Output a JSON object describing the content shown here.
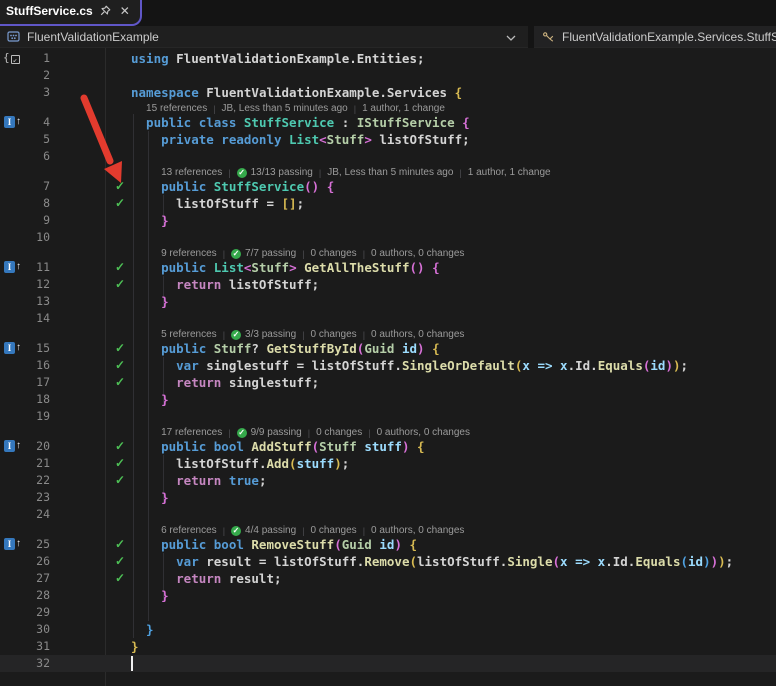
{
  "tab": {
    "title": "StuffService.cs",
    "pin_icon": "pin-icon",
    "close_icon": "✕"
  },
  "breadcrumb": {
    "project": "FluentValidationExample",
    "chevron": "⌄",
    "path": "FluentValidationExample.Services.StuffService"
  },
  "colors": {
    "accent_tab_border": "#6057c8",
    "arrow_red": "#e23b2e",
    "coverage_green": "#4dbf55",
    "codelens_pass_green": "#35a94b",
    "keyword_blue": "#569cd6",
    "control_keyword_pink": "#c586c0",
    "class_teal": "#4ec9b0",
    "type_green": "#b5cea8",
    "method_yellow": "#dcdcaa",
    "parameter_blue": "#9cdcfe",
    "bracket_gold": "#d7ba52",
    "bracket_orchid": "#d670d6",
    "bracket_blue": "#4fa1e0",
    "editor_bg": "#1b1b1b"
  },
  "editor": {
    "impl_icon_letter": "I",
    "impl_icon_arrow": "↑",
    "usings_icon_brace": "{",
    "usings_icon_arrow": "↙",
    "check_glyph": "✓",
    "cursor_line": 32,
    "lines": [
      {
        "n": 1,
        "ind": 0,
        "usings_icon": true,
        "tokens": [
          [
            "using ",
            "kw"
          ],
          [
            "FluentValidationExample.Entities;",
            "pln"
          ]
        ]
      },
      {
        "n": 2,
        "ind": 0,
        "tokens": []
      },
      {
        "n": 3,
        "ind": 0,
        "tokens": [
          [
            "namespace ",
            "kw"
          ],
          [
            "FluentValidationExample.Services ",
            "pln"
          ],
          [
            "{",
            "b1"
          ]
        ]
      },
      {
        "n": 4,
        "ind": 2,
        "impl_icon": true,
        "lens": {
          "ind": 2,
          "segs": [
            {
              "t": "15 references"
            },
            {
              "t": "JB, Less than 5 minutes ago"
            },
            {
              "t": "1 author, 1 change"
            }
          ]
        },
        "tokens": [
          [
            "public class ",
            "kw"
          ],
          [
            "StuffService",
            "cls"
          ],
          [
            " : ",
            "pln"
          ],
          [
            "IStuffService",
            "itf"
          ],
          [
            " ",
            "pln"
          ],
          [
            "{",
            "b2"
          ]
        ]
      },
      {
        "n": 5,
        "ind": 4,
        "tokens": [
          [
            "private readonly ",
            "kw"
          ],
          [
            "List",
            "cls"
          ],
          [
            "<",
            "b2"
          ],
          [
            "Stuff",
            "itf"
          ],
          [
            ">",
            "b2"
          ],
          [
            " listOfStuff;",
            "pln"
          ]
        ]
      },
      {
        "n": 6,
        "ind": 0,
        "tokens": []
      },
      {
        "n": 7,
        "ind": 4,
        "check": true,
        "lens": {
          "ind": 4,
          "segs": [
            {
              "t": "13 references"
            },
            {
              "t": "13/13 passing",
              "pass": true
            },
            {
              "t": "JB, Less than 5 minutes ago"
            },
            {
              "t": "1 author, 1 change"
            }
          ]
        },
        "tokens": [
          [
            "public ",
            "kw"
          ],
          [
            "StuffService",
            "cls"
          ],
          [
            "(",
            "b2"
          ],
          [
            ")",
            "b2"
          ],
          [
            " ",
            "pln"
          ],
          [
            "{",
            "b2"
          ]
        ]
      },
      {
        "n": 8,
        "ind": 6,
        "check": true,
        "tokens": [
          [
            "listOfStuff",
            "pln"
          ],
          [
            " = ",
            "pln"
          ],
          [
            "[]",
            "b1"
          ],
          [
            ";",
            "pln"
          ]
        ]
      },
      {
        "n": 9,
        "ind": 4,
        "tokens": [
          [
            "}",
            "b2"
          ]
        ]
      },
      {
        "n": 10,
        "ind": 0,
        "tokens": []
      },
      {
        "n": 11,
        "ind": 4,
        "impl_icon": true,
        "check": true,
        "lens": {
          "ind": 4,
          "segs": [
            {
              "t": "9 references"
            },
            {
              "t": "7/7 passing",
              "pass": true
            },
            {
              "t": "0 changes"
            },
            {
              "t": "0 authors, 0 changes"
            }
          ]
        },
        "tokens": [
          [
            "public ",
            "kw"
          ],
          [
            "List",
            "cls"
          ],
          [
            "<",
            "b2"
          ],
          [
            "Stuff",
            "itf"
          ],
          [
            ">",
            "b2"
          ],
          [
            " ",
            "pln"
          ],
          [
            "GetAllTheStuff",
            "mth"
          ],
          [
            "(",
            "b2"
          ],
          [
            ")",
            "b2"
          ],
          [
            " ",
            "pln"
          ],
          [
            "{",
            "b2"
          ]
        ]
      },
      {
        "n": 12,
        "ind": 6,
        "check": true,
        "tokens": [
          [
            "return ",
            "ctl"
          ],
          [
            "listOfStuff;",
            "pln"
          ]
        ]
      },
      {
        "n": 13,
        "ind": 4,
        "tokens": [
          [
            "}",
            "b2"
          ]
        ]
      },
      {
        "n": 14,
        "ind": 0,
        "tokens": []
      },
      {
        "n": 15,
        "ind": 4,
        "impl_icon": true,
        "check": true,
        "lens": {
          "ind": 4,
          "segs": [
            {
              "t": "5 references"
            },
            {
              "t": "3/3 passing",
              "pass": true
            },
            {
              "t": "0 changes"
            },
            {
              "t": "0 authors, 0 changes"
            }
          ]
        },
        "tokens": [
          [
            "public ",
            "kw"
          ],
          [
            "Stuff",
            "itf"
          ],
          [
            "? ",
            "pln"
          ],
          [
            "GetStuffById",
            "mth"
          ],
          [
            "(",
            "b2"
          ],
          [
            "Guid",
            "itf"
          ],
          [
            " ",
            "pln"
          ],
          [
            "id",
            "prm"
          ],
          [
            ")",
            "b2"
          ],
          [
            " ",
            "pln"
          ],
          [
            "{",
            "b1"
          ]
        ]
      },
      {
        "n": 16,
        "ind": 6,
        "check": true,
        "tokens": [
          [
            "var ",
            "kw"
          ],
          [
            "singlestuff",
            "pln"
          ],
          [
            " = ",
            "pln"
          ],
          [
            "listOfStuff",
            "pln"
          ],
          [
            ".",
            "pln"
          ],
          [
            "SingleOrDefault",
            "mth"
          ],
          [
            "(",
            "b1"
          ],
          [
            "x",
            "prm"
          ],
          [
            " ",
            "pln"
          ],
          [
            "=>",
            "prm"
          ],
          [
            " ",
            "pln"
          ],
          [
            "x",
            "prm"
          ],
          [
            ".",
            "pln"
          ],
          [
            "Id",
            "pln"
          ],
          [
            ".",
            "pln"
          ],
          [
            "Equals",
            "mth"
          ],
          [
            "(",
            "b2"
          ],
          [
            "id",
            "prm"
          ],
          [
            ")",
            "b2"
          ],
          [
            ")",
            "b1"
          ],
          [
            ";",
            "pln"
          ]
        ]
      },
      {
        "n": 17,
        "ind": 6,
        "check": true,
        "tokens": [
          [
            "return ",
            "ctl"
          ],
          [
            "singlestuff;",
            "pln"
          ]
        ]
      },
      {
        "n": 18,
        "ind": 4,
        "tokens": [
          [
            "}",
            "b2"
          ]
        ]
      },
      {
        "n": 19,
        "ind": 0,
        "tokens": []
      },
      {
        "n": 20,
        "ind": 4,
        "impl_icon": true,
        "check": true,
        "lens": {
          "ind": 4,
          "segs": [
            {
              "t": "17 references"
            },
            {
              "t": "9/9 passing",
              "pass": true
            },
            {
              "t": "0 changes"
            },
            {
              "t": "0 authors, 0 changes"
            }
          ]
        },
        "tokens": [
          [
            "public bool ",
            "kw"
          ],
          [
            "AddStuff",
            "mth"
          ],
          [
            "(",
            "b2"
          ],
          [
            "Stuff",
            "itf"
          ],
          [
            " ",
            "pln"
          ],
          [
            "stuff",
            "prm"
          ],
          [
            ")",
            "b2"
          ],
          [
            " ",
            "pln"
          ],
          [
            "{",
            "b1"
          ]
        ]
      },
      {
        "n": 21,
        "ind": 6,
        "check": true,
        "tokens": [
          [
            "listOfStuff",
            "pln"
          ],
          [
            ".",
            "pln"
          ],
          [
            "Add",
            "mth"
          ],
          [
            "(",
            "b1"
          ],
          [
            "stuff",
            "prm"
          ],
          [
            ")",
            "b1"
          ],
          [
            ";",
            "pln"
          ]
        ]
      },
      {
        "n": 22,
        "ind": 6,
        "check": true,
        "tokens": [
          [
            "return ",
            "ctl"
          ],
          [
            "true",
            "kw"
          ],
          [
            ";",
            "pln"
          ]
        ]
      },
      {
        "n": 23,
        "ind": 4,
        "tokens": [
          [
            "}",
            "b2"
          ]
        ]
      },
      {
        "n": 24,
        "ind": 0,
        "tokens": []
      },
      {
        "n": 25,
        "ind": 4,
        "impl_icon": true,
        "check": true,
        "lens": {
          "ind": 4,
          "segs": [
            {
              "t": "6 references"
            },
            {
              "t": "4/4 passing",
              "pass": true
            },
            {
              "t": "0 changes"
            },
            {
              "t": "0 authors, 0 changes"
            }
          ]
        },
        "tokens": [
          [
            "public bool ",
            "kw"
          ],
          [
            "RemoveStuff",
            "mth"
          ],
          [
            "(",
            "b2"
          ],
          [
            "Guid",
            "itf"
          ],
          [
            " ",
            "pln"
          ],
          [
            "id",
            "prm"
          ],
          [
            ")",
            "b2"
          ],
          [
            " ",
            "pln"
          ],
          [
            "{",
            "b1"
          ]
        ]
      },
      {
        "n": 26,
        "ind": 6,
        "check": true,
        "tokens": [
          [
            "var ",
            "kw"
          ],
          [
            "result",
            "pln"
          ],
          [
            " = ",
            "pln"
          ],
          [
            "listOfStuff",
            "pln"
          ],
          [
            ".",
            "pln"
          ],
          [
            "Remove",
            "mth"
          ],
          [
            "(",
            "b1"
          ],
          [
            "listOfStuff",
            "pln"
          ],
          [
            ".",
            "pln"
          ],
          [
            "Single",
            "mth"
          ],
          [
            "(",
            "b2"
          ],
          [
            "x",
            "prm"
          ],
          [
            " ",
            "pln"
          ],
          [
            "=>",
            "prm"
          ],
          [
            " ",
            "pln"
          ],
          [
            "x",
            "prm"
          ],
          [
            ".",
            "pln"
          ],
          [
            "Id",
            "pln"
          ],
          [
            ".",
            "pln"
          ],
          [
            "Equals",
            "mth"
          ],
          [
            "(",
            "b3"
          ],
          [
            "id",
            "prm"
          ],
          [
            ")",
            "b3"
          ],
          [
            ")",
            "b2"
          ],
          [
            ")",
            "b1"
          ],
          [
            ";",
            "pln"
          ]
        ]
      },
      {
        "n": 27,
        "ind": 6,
        "check": true,
        "tokens": [
          [
            "return ",
            "ctl"
          ],
          [
            "result;",
            "pln"
          ]
        ]
      },
      {
        "n": 28,
        "ind": 4,
        "tokens": [
          [
            "}",
            "b2"
          ]
        ]
      },
      {
        "n": 29,
        "ind": 0,
        "tokens": []
      },
      {
        "n": 30,
        "ind": 2,
        "tokens": [
          [
            "}",
            "b3"
          ]
        ]
      },
      {
        "n": 31,
        "ind": 0,
        "tokens": [
          [
            "}",
            "b1"
          ]
        ]
      },
      {
        "n": 32,
        "ind": 0,
        "tokens": [],
        "current": true,
        "cursor": true
      }
    ]
  }
}
